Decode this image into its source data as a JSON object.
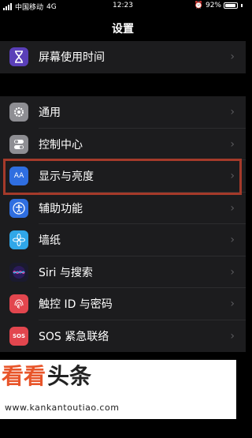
{
  "status_bar": {
    "carrier": "中国移动",
    "network": "4G",
    "time": "12:23",
    "battery": "92%",
    "battery_level": 0.92
  },
  "nav": {
    "title": "设置"
  },
  "groups": [
    {
      "items": [
        {
          "label": "屏幕使用时间",
          "icon": "hourglass-icon",
          "color": "#5a3fb8"
        }
      ]
    },
    {
      "items": [
        {
          "label": "通用",
          "icon": "gear-icon",
          "color": "#8e8e93"
        },
        {
          "label": "控制中心",
          "icon": "toggles-icon",
          "color": "#8e8e93"
        },
        {
          "label": "显示与亮度",
          "icon": "display-aa-icon",
          "color": "#2f6ee0"
        },
        {
          "label": "辅助功能",
          "icon": "accessibility-icon",
          "color": "#2f6ee0"
        },
        {
          "label": "墙纸",
          "icon": "wallpaper-flower-icon",
          "color": "#30a7e8"
        },
        {
          "label": "Siri 与搜索",
          "icon": "siri-icon",
          "color": "#1a1a2e"
        },
        {
          "label": "触控 ID 与密码",
          "icon": "fingerprint-icon",
          "color": "#e2464e"
        },
        {
          "label": "SOS 紧急联络",
          "icon": "sos-icon",
          "color": "#e2464e"
        }
      ]
    }
  ],
  "watermark": {
    "brand": "看看头条",
    "url": "www.kankantoutiao.com"
  },
  "highlight_color": "#a53a2a"
}
